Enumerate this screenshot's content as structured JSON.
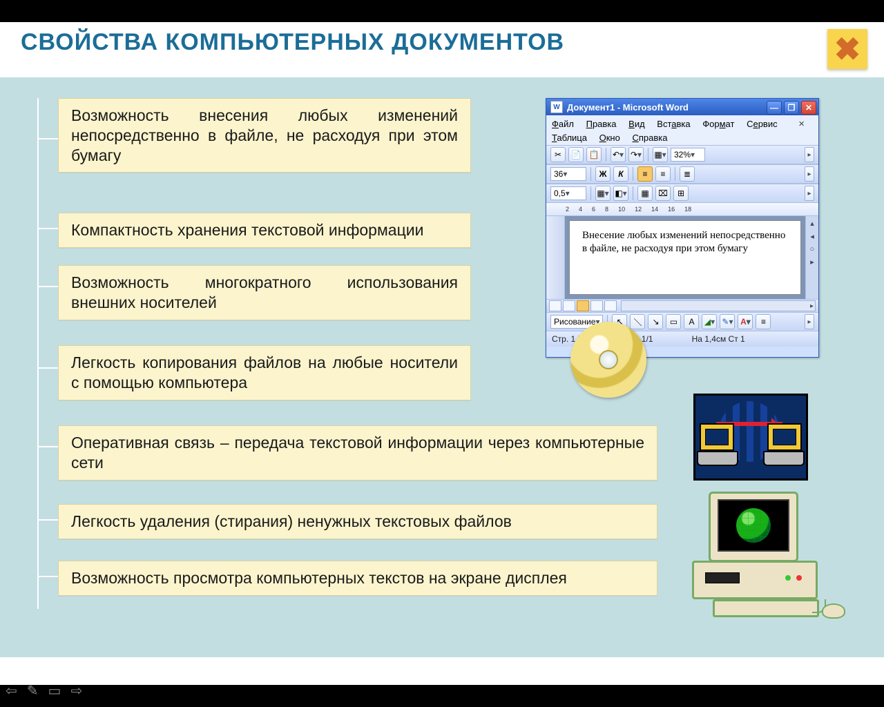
{
  "title": "СВОЙСТВА  КОМПЬЮТЕРНЫХ  ДОКУМЕНТОВ",
  "close_symbol": "✖",
  "bullets": [
    "Возможность внесения любых изменений непосредственно в файле, не расходуя при этом бумагу",
    "Компактность хранения текстовой информации",
    "Возможность многократного использования внешних носителей",
    "Легкость копирования файлов на любые носители             с помощью компьютера",
    "Оперативная связь – передача текстовой информации через компьютерные сети",
    "Легкость удаления (стирания) ненужных текстовых файлов",
    "Возможность просмотра компьютерных текстов на экране дисплея"
  ],
  "word": {
    "title": "Документ1 - Microsoft Word",
    "menus": [
      "Файл",
      "Правка",
      "Вид",
      "Вставка",
      "Формат",
      "Сервис",
      "Таблица",
      "Окно",
      "Справка"
    ],
    "zoom": "32%",
    "font_size": "36",
    "indent": "0,5",
    "ruler_marks": [
      "2",
      "4",
      "6",
      "8",
      "10",
      "12",
      "14",
      "16",
      "18"
    ],
    "body_text": "Внесение любых изменений непосредственно в файле, не расходуя при этом бумагу",
    "draw_label": "Рисование",
    "status": {
      "left": "Стр. 1       Разд 1",
      "mid": "1/1",
      "right": "На 1,4см   Ст 1"
    },
    "format_buttons": {
      "bold": "Ж",
      "italic": "К"
    }
  },
  "nav_icons": [
    "⇦",
    "✎",
    "▭",
    "⇨"
  ]
}
